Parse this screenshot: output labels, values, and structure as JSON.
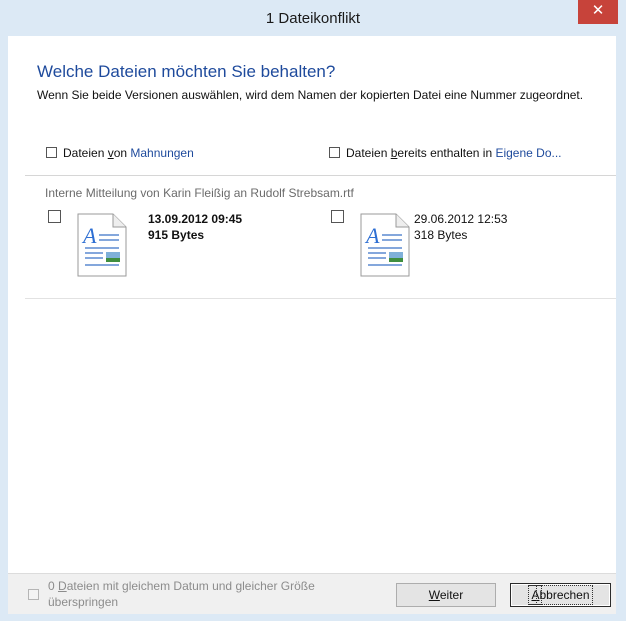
{
  "window": {
    "title": "1 Dateikonflikt",
    "close_glyph": "✕"
  },
  "header": {
    "heading": "Welche Dateien möchten Sie behalten?",
    "description": "Wenn Sie beide Versionen auswählen, wird dem Namen der kopierten Datei eine Nummer zugeordnet."
  },
  "columns": {
    "left": {
      "prefix": "Dateien ",
      "access_key": "v",
      "after_key": "on ",
      "link": "Mahnungen"
    },
    "right": {
      "prefix": "Dateien ",
      "access_key": "b",
      "after_key": "ereits enthalten in ",
      "link": "Eigene Do..."
    }
  },
  "conflict": {
    "filename": "Interne Mitteilung von Karin Fleißig an Rudolf Strebsam.rtf",
    "source": {
      "date": "13.09.2012 09:45",
      "size": "915 Bytes",
      "icon": "rtf-document-icon"
    },
    "destination": {
      "date": "29.06.2012 12:53",
      "size": "318 Bytes",
      "icon": "rtf-document-icon"
    }
  },
  "footer": {
    "skip_label_line1_prefix": "0 ",
    "skip_label_key": "D",
    "skip_label_line1_rest": "ateien mit gleichem Datum und gleicher Größe",
    "skip_label_line2": "überspringen",
    "continue_key": "W",
    "continue_rest": "eiter",
    "cancel_key": "A",
    "cancel_rest": "bbrechen"
  },
  "colors": {
    "frame": "#dce9f5",
    "close": "#c7433a",
    "accent": "#1e4a9c"
  }
}
